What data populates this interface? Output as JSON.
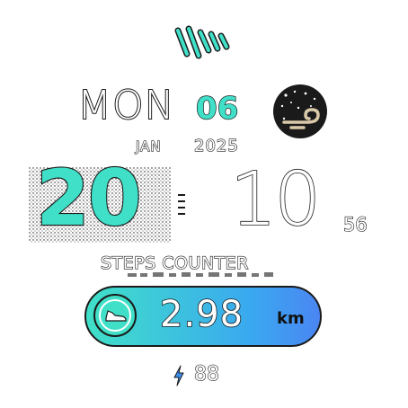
{
  "date": {
    "day_of_week": "MON",
    "day_number": "06",
    "month": "JAN",
    "year": "2025"
  },
  "time": {
    "hour": "20",
    "minute": "10",
    "second": "56"
  },
  "steps": {
    "label": "STEPS COUNTER",
    "distance": "2.98",
    "unit": "km"
  },
  "battery": {
    "level": "88"
  },
  "icons": {
    "logo": "brand-logo-icon",
    "weather": "night-cloud-icon",
    "shoe": "shoe-icon",
    "bolt": "lightning-bolt-icon"
  },
  "colors": {
    "accent": "#40e0c8",
    "accent_blue": "#4a86f2",
    "outline": "#1a1a1a"
  }
}
